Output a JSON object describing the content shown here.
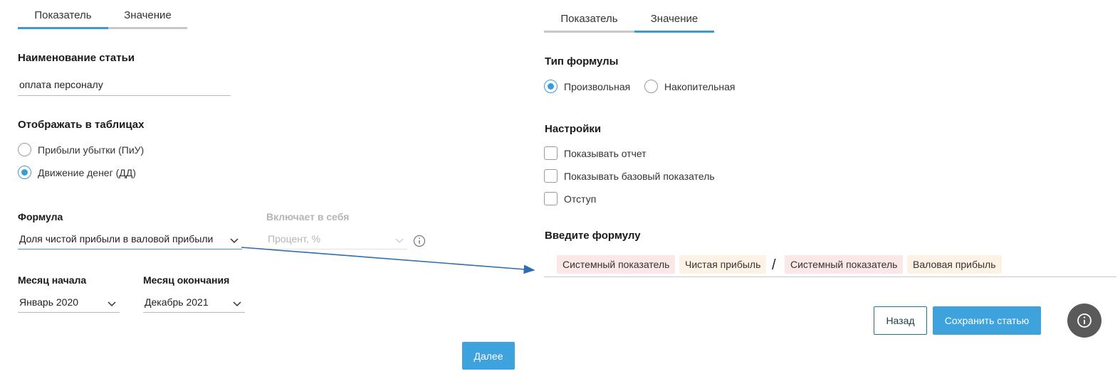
{
  "left": {
    "tabs": [
      {
        "label": "Показатель",
        "active": true
      },
      {
        "label": "Значение",
        "active": false
      }
    ],
    "article_name": {
      "label": "Наименование статьи",
      "value": "оплата персоналу"
    },
    "display_in_tables": {
      "label": "Отображать в таблицах",
      "options": [
        {
          "label": "Прибыли убытки (ПиУ)",
          "checked": false
        },
        {
          "label": "Движение денег (ДД)",
          "checked": true
        }
      ]
    },
    "formula": {
      "label": "Формула",
      "value": "Доля чистой прибыли в валовой прибыли"
    },
    "includes": {
      "label": "Включает в себя",
      "value": "Процент, %"
    },
    "start_month": {
      "label": "Месяц начала",
      "value": "Январь 2020"
    },
    "end_month": {
      "label": "Месяц окончания",
      "value": "Декабрь 2021"
    },
    "next_label": "Далее"
  },
  "right": {
    "tabs": [
      {
        "label": "Показатель",
        "active": false
      },
      {
        "label": "Значение",
        "active": true
      }
    ],
    "formula_type": {
      "label": "Тип формулы",
      "options": [
        {
          "label": "Произвольная",
          "checked": true
        },
        {
          "label": "Накопительная",
          "checked": false
        }
      ]
    },
    "settings": {
      "label": "Настройки",
      "options": [
        {
          "label": "Показывать отчет",
          "checked": false
        },
        {
          "label": "Показывать базовый показатель",
          "checked": false
        },
        {
          "label": "Отступ",
          "checked": false
        }
      ]
    },
    "formula_input": {
      "label": "Введите формулу",
      "tokens": [
        {
          "text": "Системный показатель"
        },
        {
          "text": "Чистая прибыль"
        },
        {
          "text": "/"
        },
        {
          "text": "Системный показатель"
        },
        {
          "text": "Валовая прибыль"
        }
      ]
    },
    "back_label": "Назад",
    "save_label": "Сохранить статью"
  },
  "colors": {
    "accent": "#3a9bd9",
    "chip_system": "#fbe7e6",
    "chip_value": "#fdf2e3",
    "fab": "#5a5a5a"
  },
  "icons": {
    "info": "info-icon",
    "chevron": "chevron-down-icon"
  }
}
